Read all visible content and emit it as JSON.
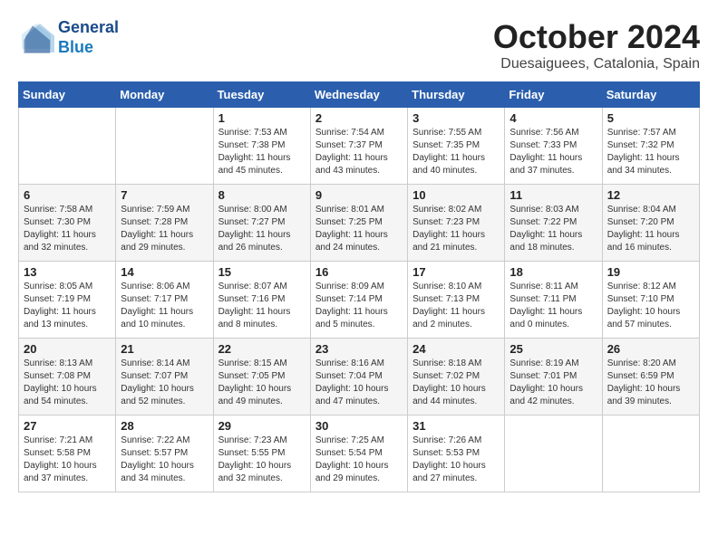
{
  "logo": {
    "line1": "General",
    "line2": "Blue"
  },
  "title": "October 2024",
  "subtitle": "Duesaiguees, Catalonia, Spain",
  "days_of_week": [
    "Sunday",
    "Monday",
    "Tuesday",
    "Wednesday",
    "Thursday",
    "Friday",
    "Saturday"
  ],
  "weeks": [
    [
      {
        "day": "",
        "sunrise": "",
        "sunset": "",
        "daylight": ""
      },
      {
        "day": "",
        "sunrise": "",
        "sunset": "",
        "daylight": ""
      },
      {
        "day": "1",
        "sunrise": "Sunrise: 7:53 AM",
        "sunset": "Sunset: 7:38 PM",
        "daylight": "Daylight: 11 hours and 45 minutes."
      },
      {
        "day": "2",
        "sunrise": "Sunrise: 7:54 AM",
        "sunset": "Sunset: 7:37 PM",
        "daylight": "Daylight: 11 hours and 43 minutes."
      },
      {
        "day": "3",
        "sunrise": "Sunrise: 7:55 AM",
        "sunset": "Sunset: 7:35 PM",
        "daylight": "Daylight: 11 hours and 40 minutes."
      },
      {
        "day": "4",
        "sunrise": "Sunrise: 7:56 AM",
        "sunset": "Sunset: 7:33 PM",
        "daylight": "Daylight: 11 hours and 37 minutes."
      },
      {
        "day": "5",
        "sunrise": "Sunrise: 7:57 AM",
        "sunset": "Sunset: 7:32 PM",
        "daylight": "Daylight: 11 hours and 34 minutes."
      }
    ],
    [
      {
        "day": "6",
        "sunrise": "Sunrise: 7:58 AM",
        "sunset": "Sunset: 7:30 PM",
        "daylight": "Daylight: 11 hours and 32 minutes."
      },
      {
        "day": "7",
        "sunrise": "Sunrise: 7:59 AM",
        "sunset": "Sunset: 7:28 PM",
        "daylight": "Daylight: 11 hours and 29 minutes."
      },
      {
        "day": "8",
        "sunrise": "Sunrise: 8:00 AM",
        "sunset": "Sunset: 7:27 PM",
        "daylight": "Daylight: 11 hours and 26 minutes."
      },
      {
        "day": "9",
        "sunrise": "Sunrise: 8:01 AM",
        "sunset": "Sunset: 7:25 PM",
        "daylight": "Daylight: 11 hours and 24 minutes."
      },
      {
        "day": "10",
        "sunrise": "Sunrise: 8:02 AM",
        "sunset": "Sunset: 7:23 PM",
        "daylight": "Daylight: 11 hours and 21 minutes."
      },
      {
        "day": "11",
        "sunrise": "Sunrise: 8:03 AM",
        "sunset": "Sunset: 7:22 PM",
        "daylight": "Daylight: 11 hours and 18 minutes."
      },
      {
        "day": "12",
        "sunrise": "Sunrise: 8:04 AM",
        "sunset": "Sunset: 7:20 PM",
        "daylight": "Daylight: 11 hours and 16 minutes."
      }
    ],
    [
      {
        "day": "13",
        "sunrise": "Sunrise: 8:05 AM",
        "sunset": "Sunset: 7:19 PM",
        "daylight": "Daylight: 11 hours and 13 minutes."
      },
      {
        "day": "14",
        "sunrise": "Sunrise: 8:06 AM",
        "sunset": "Sunset: 7:17 PM",
        "daylight": "Daylight: 11 hours and 10 minutes."
      },
      {
        "day": "15",
        "sunrise": "Sunrise: 8:07 AM",
        "sunset": "Sunset: 7:16 PM",
        "daylight": "Daylight: 11 hours and 8 minutes."
      },
      {
        "day": "16",
        "sunrise": "Sunrise: 8:09 AM",
        "sunset": "Sunset: 7:14 PM",
        "daylight": "Daylight: 11 hours and 5 minutes."
      },
      {
        "day": "17",
        "sunrise": "Sunrise: 8:10 AM",
        "sunset": "Sunset: 7:13 PM",
        "daylight": "Daylight: 11 hours and 2 minutes."
      },
      {
        "day": "18",
        "sunrise": "Sunrise: 8:11 AM",
        "sunset": "Sunset: 7:11 PM",
        "daylight": "Daylight: 11 hours and 0 minutes."
      },
      {
        "day": "19",
        "sunrise": "Sunrise: 8:12 AM",
        "sunset": "Sunset: 7:10 PM",
        "daylight": "Daylight: 10 hours and 57 minutes."
      }
    ],
    [
      {
        "day": "20",
        "sunrise": "Sunrise: 8:13 AM",
        "sunset": "Sunset: 7:08 PM",
        "daylight": "Daylight: 10 hours and 54 minutes."
      },
      {
        "day": "21",
        "sunrise": "Sunrise: 8:14 AM",
        "sunset": "Sunset: 7:07 PM",
        "daylight": "Daylight: 10 hours and 52 minutes."
      },
      {
        "day": "22",
        "sunrise": "Sunrise: 8:15 AM",
        "sunset": "Sunset: 7:05 PM",
        "daylight": "Daylight: 10 hours and 49 minutes."
      },
      {
        "day": "23",
        "sunrise": "Sunrise: 8:16 AM",
        "sunset": "Sunset: 7:04 PM",
        "daylight": "Daylight: 10 hours and 47 minutes."
      },
      {
        "day": "24",
        "sunrise": "Sunrise: 8:18 AM",
        "sunset": "Sunset: 7:02 PM",
        "daylight": "Daylight: 10 hours and 44 minutes."
      },
      {
        "day": "25",
        "sunrise": "Sunrise: 8:19 AM",
        "sunset": "Sunset: 7:01 PM",
        "daylight": "Daylight: 10 hours and 42 minutes."
      },
      {
        "day": "26",
        "sunrise": "Sunrise: 8:20 AM",
        "sunset": "Sunset: 6:59 PM",
        "daylight": "Daylight: 10 hours and 39 minutes."
      }
    ],
    [
      {
        "day": "27",
        "sunrise": "Sunrise: 7:21 AM",
        "sunset": "Sunset: 5:58 PM",
        "daylight": "Daylight: 10 hours and 37 minutes."
      },
      {
        "day": "28",
        "sunrise": "Sunrise: 7:22 AM",
        "sunset": "Sunset: 5:57 PM",
        "daylight": "Daylight: 10 hours and 34 minutes."
      },
      {
        "day": "29",
        "sunrise": "Sunrise: 7:23 AM",
        "sunset": "Sunset: 5:55 PM",
        "daylight": "Daylight: 10 hours and 32 minutes."
      },
      {
        "day": "30",
        "sunrise": "Sunrise: 7:25 AM",
        "sunset": "Sunset: 5:54 PM",
        "daylight": "Daylight: 10 hours and 29 minutes."
      },
      {
        "day": "31",
        "sunrise": "Sunrise: 7:26 AM",
        "sunset": "Sunset: 5:53 PM",
        "daylight": "Daylight: 10 hours and 27 minutes."
      },
      {
        "day": "",
        "sunrise": "",
        "sunset": "",
        "daylight": ""
      },
      {
        "day": "",
        "sunrise": "",
        "sunset": "",
        "daylight": ""
      }
    ]
  ]
}
